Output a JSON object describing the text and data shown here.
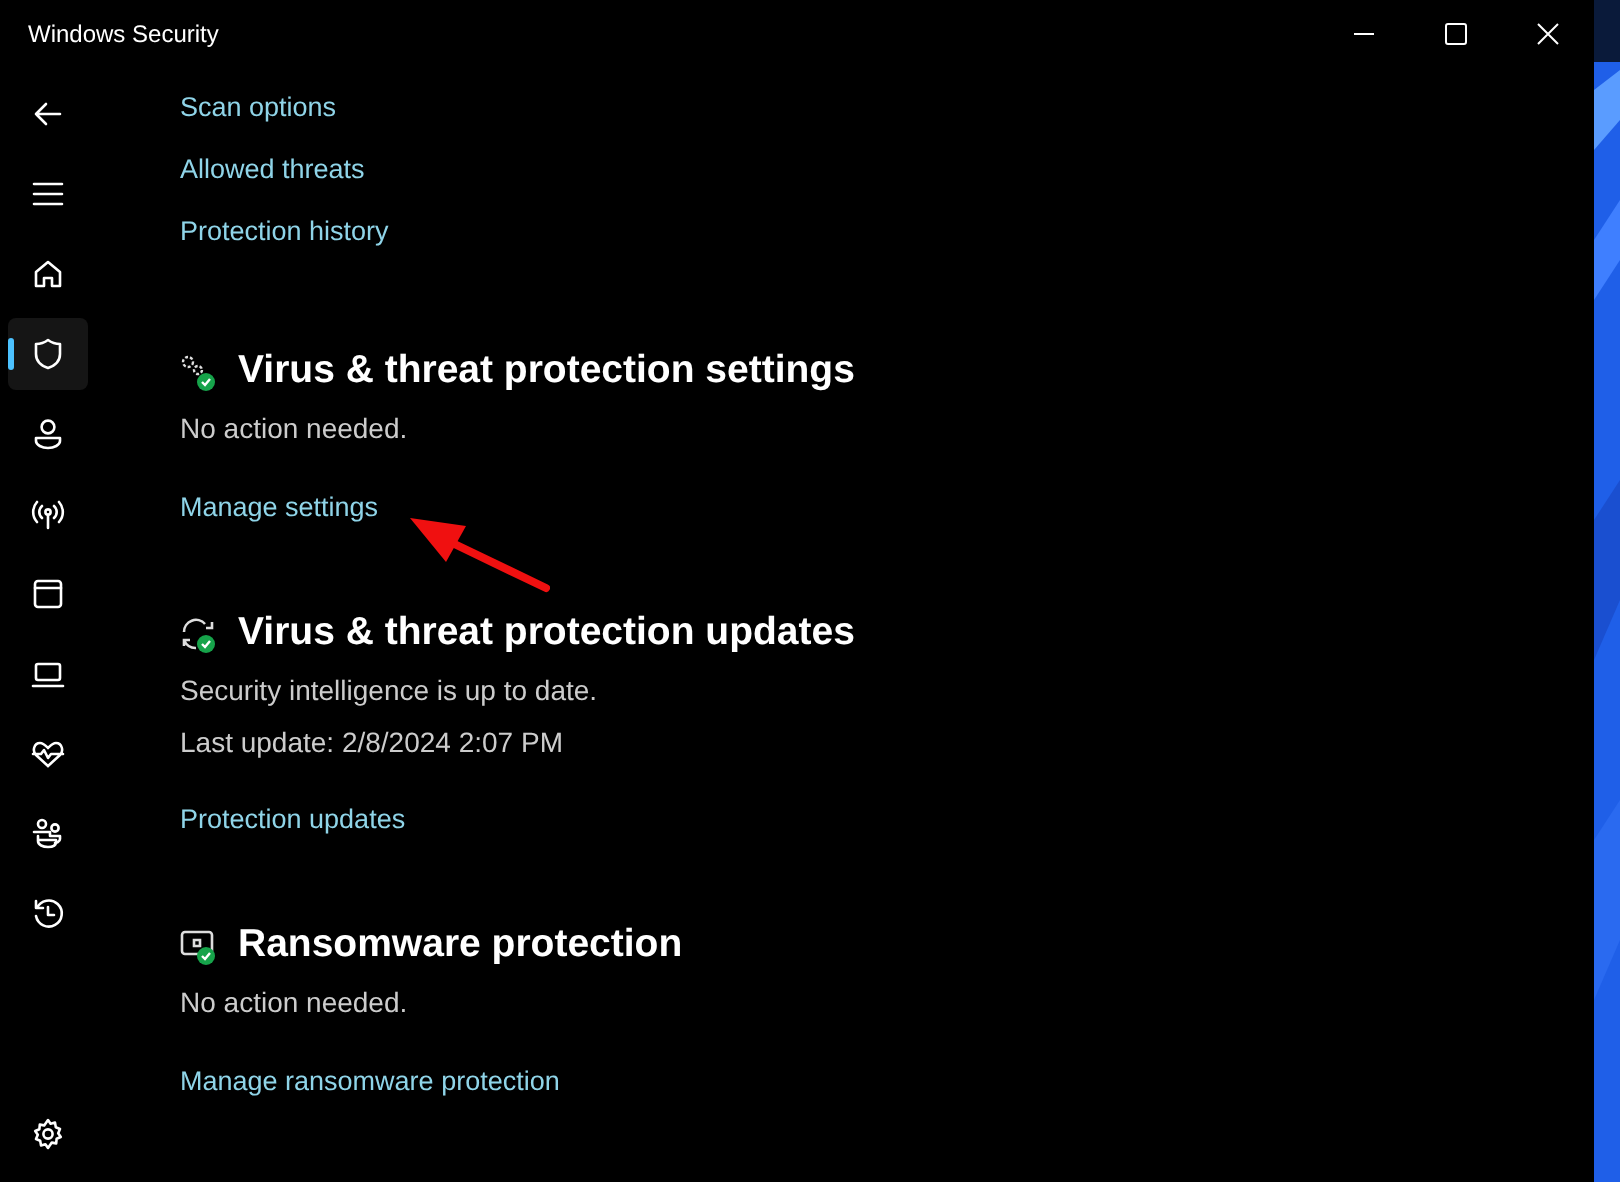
{
  "window": {
    "title": "Windows Security"
  },
  "sidebar": {
    "items": [
      {
        "kind": "back",
        "selected": false
      },
      {
        "kind": "menu",
        "selected": false
      },
      {
        "kind": "home",
        "selected": false
      },
      {
        "kind": "shield",
        "selected": true
      },
      {
        "kind": "account",
        "selected": false
      },
      {
        "kind": "network",
        "selected": false
      },
      {
        "kind": "browser",
        "selected": false
      },
      {
        "kind": "device",
        "selected": false
      },
      {
        "kind": "health",
        "selected": false
      },
      {
        "kind": "family",
        "selected": false
      },
      {
        "kind": "history",
        "selected": false
      }
    ],
    "footer": {
      "kind": "settings",
      "selected": false
    }
  },
  "links": [
    "Scan options",
    "Allowed threats",
    "Protection history"
  ],
  "sections": [
    {
      "kind": "settings",
      "title": "Virus & threat protection settings",
      "lines": [
        "No action needed."
      ],
      "link": "Manage settings",
      "annotated": true
    },
    {
      "kind": "updates",
      "title": "Virus & threat protection updates",
      "lines": [
        "Security intelligence is up to date.",
        "Last update: 2/8/2024 2:07 PM"
      ],
      "link": "Protection updates",
      "annotated": false
    },
    {
      "kind": "ransomware",
      "title": "Ransomware protection",
      "lines": [
        "No action needed."
      ],
      "link": "Manage ransomware protection",
      "annotated": false
    }
  ]
}
